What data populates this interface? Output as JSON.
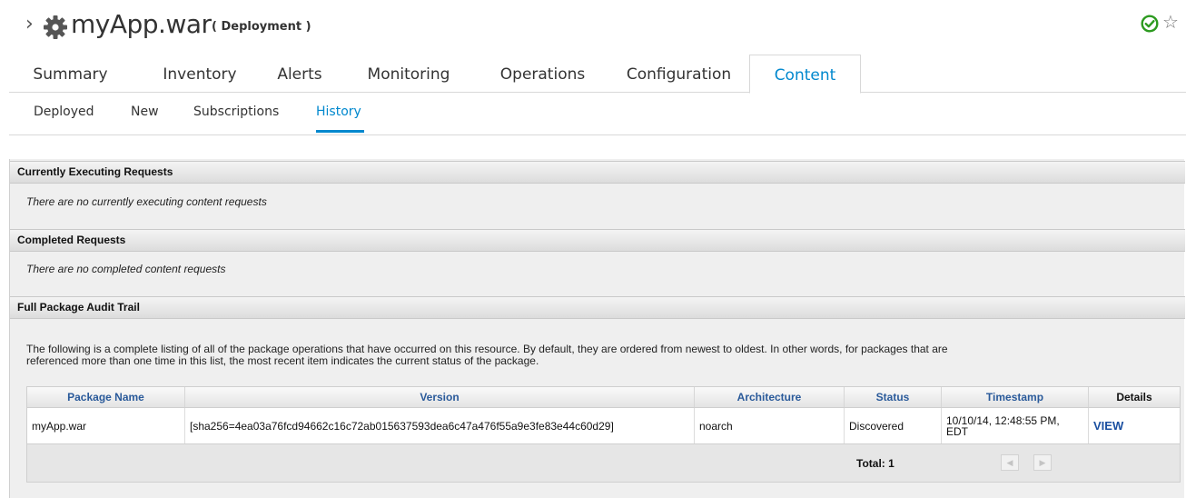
{
  "header": {
    "chevron": "›",
    "title": "myApp.war",
    "type_label": "( Deployment )",
    "fav_glyph": "☆"
  },
  "icons": {
    "app": "gear-icon",
    "availability": "check-circle-icon",
    "favorite": "star-icon"
  },
  "colors": {
    "accent": "#0088ce",
    "available": "#2c9a1f",
    "link": "#1a4fa0"
  },
  "main_tabs": [
    {
      "label": "Summary"
    },
    {
      "label": "Inventory"
    },
    {
      "label": "Alerts"
    },
    {
      "label": "Monitoring"
    },
    {
      "label": "Operations"
    },
    {
      "label": "Configuration"
    },
    {
      "label": "Content",
      "active": true
    }
  ],
  "sub_tabs": [
    {
      "label": "Deployed"
    },
    {
      "label": "New"
    },
    {
      "label": "Subscriptions"
    },
    {
      "label": "History",
      "active": true
    }
  ],
  "sections": {
    "executing": {
      "title": "Currently Executing Requests",
      "message": "There are no currently executing content requests"
    },
    "completed": {
      "title": "Completed Requests",
      "message": "There are no completed content requests"
    },
    "audit": {
      "title": "Full Package Audit Trail",
      "description_line1": "The following is a complete listing of all of the package operations that have occurred on this resource. By default, they are ordered from newest to oldest. In other words, for packages that are",
      "description_line2": "referenced more than one time in this list, the most recent item indicates the current status of the package."
    }
  },
  "table": {
    "columns": [
      "Package Name",
      "Version",
      "Architecture",
      "Status",
      "Timestamp",
      "Details"
    ],
    "rows": [
      {
        "package_name": "myApp.war",
        "version": "[sha256=4ea03a76fcd94662c16c72ab015637593dea6c47a476f55a9e3fe83e44c60d29]",
        "architecture": "noarch",
        "status": "Discovered",
        "timestamp_line1": "10/10/14, 12:48:55 PM,",
        "timestamp_line2": "EDT",
        "details": "VIEW"
      }
    ],
    "total": "Total: 1",
    "pager_prev": "◀",
    "pager_next": "▶"
  }
}
